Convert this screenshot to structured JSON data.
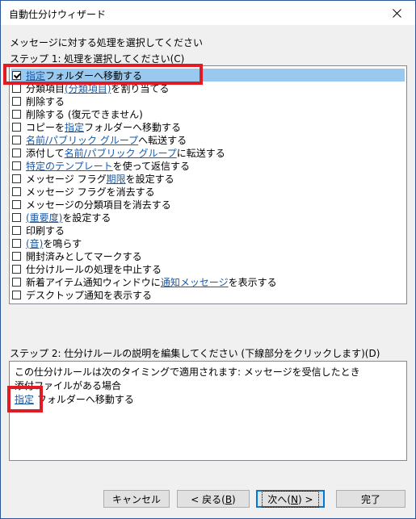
{
  "window": {
    "title": "自動仕分けウィザード",
    "close_label": "✕"
  },
  "prompt": "メッセージに対する処理を選択してください",
  "step1": {
    "label": "ステップ 1: 処理を選択してください(C)",
    "items": [
      {
        "checked": true,
        "parts": [
          [
            "指定",
            true
          ],
          [
            " フォルダーへ移動する",
            false
          ]
        ]
      },
      {
        "checked": false,
        "parts": [
          [
            "分類項目 ",
            false
          ],
          [
            "(分類項目)",
            true
          ],
          [
            " を割り当てる",
            false
          ]
        ]
      },
      {
        "checked": false,
        "parts": [
          [
            "削除する",
            false
          ]
        ]
      },
      {
        "checked": false,
        "parts": [
          [
            "削除する (復元できません)",
            false
          ]
        ]
      },
      {
        "checked": false,
        "parts": [
          [
            "コピーを ",
            false
          ],
          [
            "指定",
            true
          ],
          [
            " フォルダーへ移動する",
            false
          ]
        ]
      },
      {
        "checked": false,
        "parts": [
          [
            "名前/パブリック グループ",
            true
          ],
          [
            " へ転送する",
            false
          ]
        ]
      },
      {
        "checked": false,
        "parts": [
          [
            "添付して ",
            false
          ],
          [
            "名前/パブリック グループ",
            true
          ],
          [
            " に転送する",
            false
          ]
        ]
      },
      {
        "checked": false,
        "parts": [
          [
            "特定のテンプレート",
            true
          ],
          [
            " を使って返信する",
            false
          ]
        ]
      },
      {
        "checked": false,
        "parts": [
          [
            "メッセージ フラグ ",
            false
          ],
          [
            "期限",
            true
          ],
          [
            " を設定する",
            false
          ]
        ]
      },
      {
        "checked": false,
        "parts": [
          [
            "メッセージ フラグを消去する",
            false
          ]
        ]
      },
      {
        "checked": false,
        "parts": [
          [
            "メッセージの分類項目を消去する",
            false
          ]
        ]
      },
      {
        "checked": false,
        "parts": [
          [
            "(重要度)",
            true
          ],
          [
            " を設定する",
            false
          ]
        ]
      },
      {
        "checked": false,
        "parts": [
          [
            "印刷する",
            false
          ]
        ]
      },
      {
        "checked": false,
        "parts": [
          [
            "(音)",
            true
          ],
          [
            " を鳴らす",
            false
          ]
        ]
      },
      {
        "checked": false,
        "parts": [
          [
            "開封済みとしてマークする",
            false
          ]
        ]
      },
      {
        "checked": false,
        "parts": [
          [
            "仕分けルールの処理を中止する",
            false
          ]
        ]
      },
      {
        "checked": false,
        "parts": [
          [
            "新着アイテム通知ウィンドウに ",
            false
          ],
          [
            "通知メッセージ",
            true
          ],
          [
            " を表示する",
            false
          ]
        ]
      },
      {
        "checked": false,
        "parts": [
          [
            "デスクトップ通知を表示する",
            false
          ]
        ]
      }
    ]
  },
  "step2": {
    "label": "ステップ 2: 仕分けルールの説明を編集してください (下線部分をクリックします)(D)",
    "lines": [
      [
        [
          "この仕分けルールは次のタイミングで適用されます: メッセージを受信したとき",
          false
        ]
      ],
      [
        [
          "添付ファイルがある場合",
          false
        ]
      ],
      [
        [
          "指定",
          true
        ],
        [
          " フォルダーへ移動する",
          false
        ]
      ]
    ]
  },
  "buttons": {
    "cancel": "キャンセル",
    "back_pre": "< 戻る(",
    "back_key": "B",
    "back_post": ")",
    "next_pre": "次へ(",
    "next_key": "N",
    "next_post": ") >",
    "finish": "完了"
  }
}
